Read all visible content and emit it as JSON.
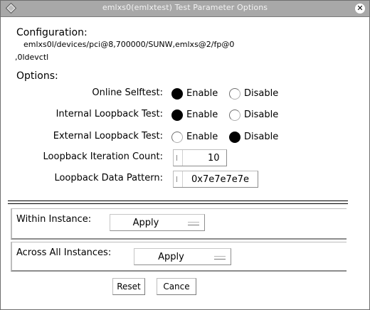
{
  "window": {
    "title": "emlxs0(emlxtest) Test Parameter Options",
    "close_glyph": "✕"
  },
  "configuration": {
    "heading": "Configuration:",
    "path_line1": "emlxs0l/devices/pci@8,700000/SUNW,emlxs@2/fp@0",
    "path_line2": ",0ldevctl"
  },
  "options": {
    "heading": "Options:",
    "online_selftest": {
      "label": "Online Selftest:",
      "options": [
        "Enable",
        "Disable"
      ],
      "selected": "Enable"
    },
    "internal_loopback": {
      "label": "Internal Loopback Test:",
      "options": [
        "Enable",
        "Disable"
      ],
      "selected": "Enable"
    },
    "external_loopback": {
      "label": "External Loopback Test:",
      "options": [
        "Enable",
        "Disable"
      ],
      "selected": "Disable"
    },
    "iteration_count": {
      "label": "Loopback Iteration Count:",
      "value": "10"
    },
    "data_pattern": {
      "label": "Loopback Data Pattern:",
      "value": "0x7e7e7e7e"
    }
  },
  "within_instance": {
    "label": "Within Instance:",
    "value": "Apply"
  },
  "across_instances": {
    "label": "Across All Instances:",
    "value": "Apply"
  },
  "buttons": {
    "reset": "Reset",
    "cancel": "Cance"
  },
  "icons": {
    "title_icon": "diamond-menu-icon",
    "close_icon": "close-icon"
  },
  "colors": {
    "titlebar": "#a8a8a8",
    "background": "#ffffff",
    "radio_selected": "#000000"
  }
}
